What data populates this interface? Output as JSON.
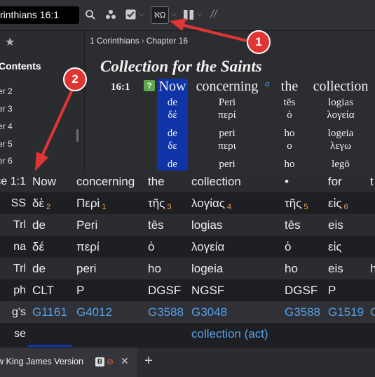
{
  "toolbar": {
    "search_value": "rinthians 16:1",
    "icons": [
      "search-icon",
      "share-icon",
      "checklist-icon",
      "interlinear-icon",
      "columns-icon",
      "parallel-icon"
    ],
    "interlinear_glyph": "ℵΩ",
    "parallel_glyph": "//"
  },
  "leftnav": {
    "contents_label": "Contents",
    "chapters": [
      "er 2",
      "er 3",
      "er 4",
      "er 5",
      "er 6"
    ]
  },
  "reader": {
    "breadcrumb": [
      "1 Corinthians",
      "Chapter 16"
    ],
    "section_heading": "Collection for the Saints",
    "verse_ref": "16:1",
    "verse_marker": "?",
    "footnote": "a",
    "words": [
      {
        "en": "Now",
        "l1": "de",
        "l2": "δέ",
        "l3": "de",
        "l4": "δε",
        "l5": "de"
      },
      {
        "en": "concerning",
        "l1": "Peri",
        "l2": "περί",
        "l3": "peri",
        "l4": "περι",
        "l5": "peri"
      },
      {
        "en": "the",
        "l1": "tēs",
        "l2": "ὁ",
        "l3": "ho",
        "l4": "ο",
        "l5": "ho"
      },
      {
        "en": "collection",
        "l1": "logias",
        "l2": "λογεία",
        "l3": "logeia",
        "l4": "λεγω",
        "l5": "legō"
      }
    ]
  },
  "table": {
    "row_labels": [
      "ce 1:1",
      "SS",
      "Trl",
      "na",
      "Trl",
      "ph",
      "g's",
      "se"
    ],
    "columns": [
      {
        "cells": [
          "Now",
          "δὲ",
          "de",
          "δέ",
          "de",
          "CLT",
          "G1161",
          ""
        ],
        "sub": [
          "",
          "2",
          "",
          "",
          "",
          "",
          "",
          ""
        ]
      },
      {
        "cells": [
          "concerning",
          "Περὶ",
          "Peri",
          "περί",
          "peri",
          "P",
          "G4012",
          ""
        ],
        "sub": [
          "",
          "1",
          "",
          "",
          "",
          "",
          "",
          ""
        ]
      },
      {
        "cells": [
          "the",
          "τῆς",
          "tēs",
          "ὁ",
          "ho",
          "DGSF",
          "G3588",
          ""
        ],
        "sub": [
          "",
          "3",
          "",
          "",
          "",
          "",
          "",
          ""
        ]
      },
      {
        "cells": [
          "collection",
          "λογίας",
          "logias",
          "λογεία",
          "logeia",
          "NGSF",
          "G3048",
          "collection (act)"
        ],
        "sub": [
          "",
          "4",
          "",
          "",
          "",
          "",
          "",
          ""
        ]
      },
      {
        "cells": [
          "•",
          "τῆς",
          "tēs",
          "ὁ",
          "ho",
          "DGSF",
          "G3588",
          ""
        ],
        "sub": [
          "",
          "5",
          "",
          "",
          "",
          "",
          "",
          ""
        ]
      },
      {
        "cells": [
          "for",
          "εἰς",
          "eis",
          "εἰς",
          "eis",
          "P",
          "G1519",
          ""
        ],
        "sub": [
          "",
          "6",
          "",
          "",
          "",
          "",
          "",
          ""
        ]
      },
      {
        "cells": [
          "t",
          "",
          "",
          "",
          "h",
          "",
          "G",
          ""
        ],
        "sub": [
          "",
          "",
          "",
          "",
          "",
          "",
          "",
          ""
        ]
      }
    ]
  },
  "tabs": {
    "active_label": "w King James Version",
    "badge": "B",
    "close_glyph": "✕",
    "add_glyph": "+"
  },
  "annotations": {
    "callout_1": "1",
    "callout_2": "2"
  },
  "colors": {
    "highlight": "#0f34a8",
    "link": "#58a0e6",
    "callout": "#e03535",
    "subscript": "#f2a65a"
  }
}
